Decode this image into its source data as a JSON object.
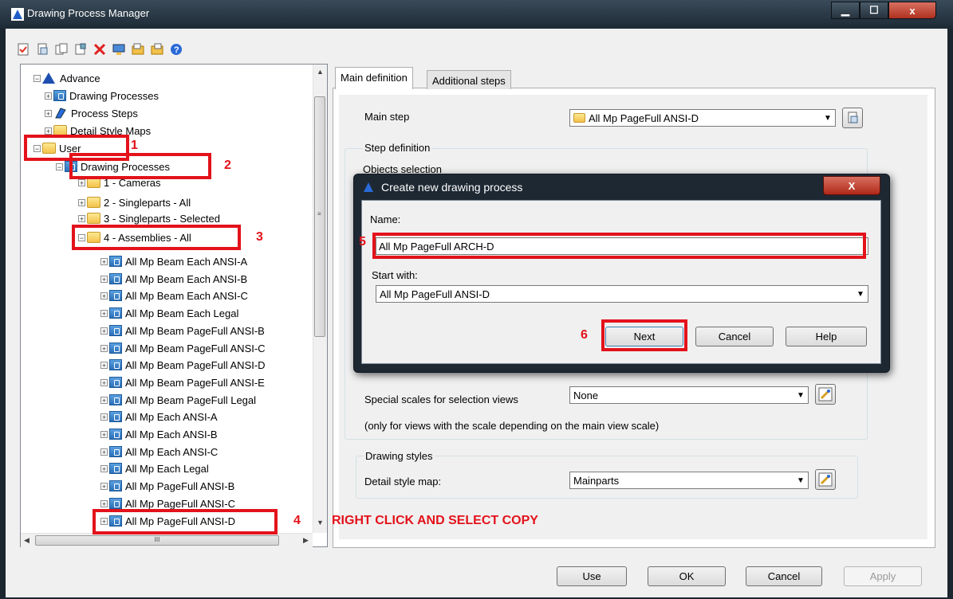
{
  "window": {
    "title": "Drawing Process Manager",
    "minimize": "▁",
    "maximize": "☐",
    "close": "x"
  },
  "toolbar": {
    "icons": [
      "new-icon",
      "copy-icon",
      "paste-icon",
      "duplicate-icon",
      "delete-icon",
      "import-icon",
      "export-icon",
      "export2-icon",
      "help-icon"
    ]
  },
  "tree": {
    "advance": "Advance",
    "drawing_processes": "Drawing Processes",
    "process_steps": "Process Steps",
    "detail_style_maps": "Detail Style Maps",
    "user": "User",
    "user_drawing_processes": "Drawing Processes",
    "folders": [
      "1 - Cameras",
      "2 - Singleparts - All",
      "3 - Singleparts - Selected",
      "4 - Assemblies - All"
    ],
    "items": [
      "All Mp Beam Each ANSI-A",
      "All Mp Beam Each ANSI-B",
      "All Mp Beam Each ANSI-C",
      "All Mp Beam Each Legal",
      "All Mp Beam PageFull ANSI-B",
      "All Mp Beam PageFull ANSI-C",
      "All Mp Beam PageFull ANSI-D",
      "All Mp Beam PageFull ANSI-E",
      "All Mp Beam PageFull Legal",
      "All Mp Each ANSI-A",
      "All Mp Each ANSI-B",
      "All Mp Each ANSI-C",
      "All Mp Each Legal",
      "All Mp PageFull ANSI-B",
      "All Mp PageFull ANSI-C",
      "All Mp PageFull ANSI-D"
    ],
    "hscroll_label": "III"
  },
  "tabs": {
    "main": "Main definition",
    "additional": "Additional steps"
  },
  "main": {
    "main_step_label": "Main step",
    "main_step_value": "All Mp PageFull ANSI-D",
    "step_definition": "Step definition",
    "objects_selection": "Objects selection",
    "special_scales_label": "Special scales for selection views",
    "special_scales_value": "None",
    "scales_note": "(only for views with the scale depending on the main view scale)",
    "drawing_styles": "Drawing styles",
    "detail_style_map_label": "Detail style map:",
    "detail_style_map_value": "Mainparts"
  },
  "dialog": {
    "title": "Create new drawing process",
    "close": "X",
    "name_label": "Name:",
    "name_value": "All Mp PageFull ARCH-D",
    "start_with_label": "Start with:",
    "start_with_value": "All Mp PageFull ANSI-D",
    "next": "Next",
    "cancel": "Cancel",
    "help": "Help"
  },
  "footer": {
    "use": "Use",
    "ok": "OK",
    "cancel": "Cancel",
    "apply": "Apply"
  },
  "annotations": {
    "n1": "1",
    "n2": "2",
    "n3": "3",
    "n4": "4",
    "n5": "5",
    "n6": "6",
    "instruction": "RIGHT CLICK AND SELECT COPY"
  },
  "colors": {
    "annotation_red": "#e3121b",
    "title_bar": "#1d2a36"
  }
}
